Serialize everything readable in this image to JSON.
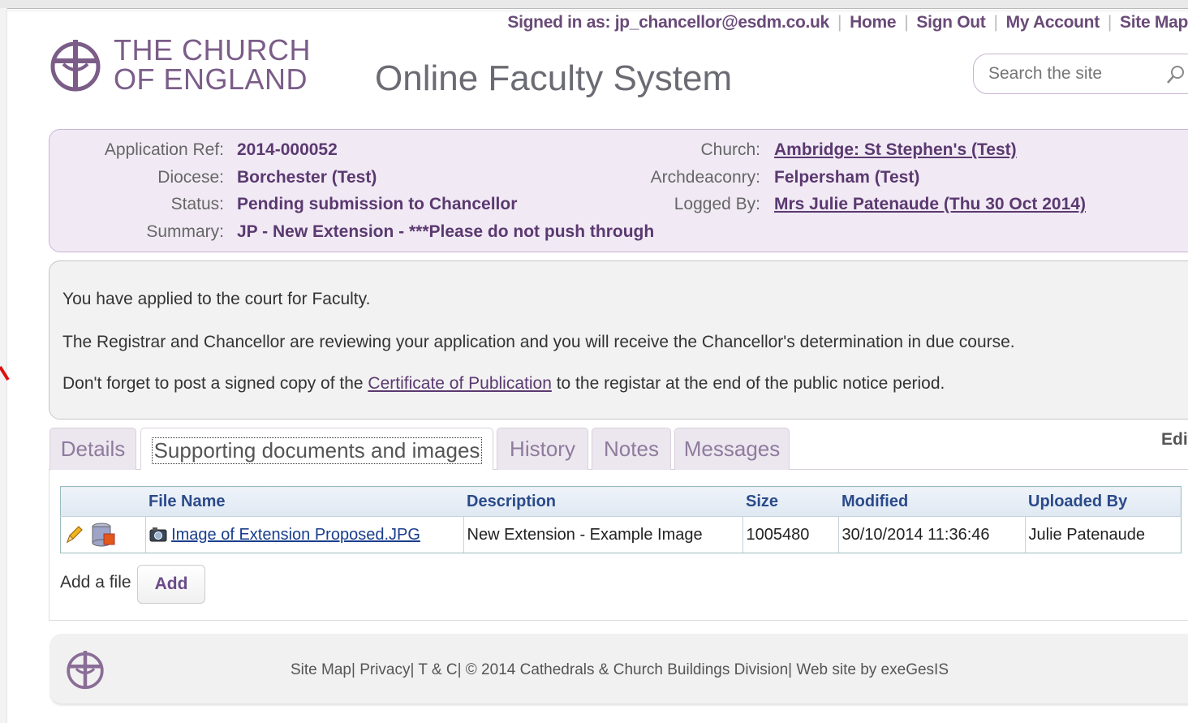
{
  "header": {
    "signed_in": "Signed in as: jp_chancellor@esdm.co.uk",
    "nav": [
      "Home",
      "Sign Out",
      "My Account",
      "Site Map"
    ],
    "logo_line1": "THE CHURCH",
    "logo_line2": "OF ENGLAND",
    "site_title": "Online Faculty System",
    "search_placeholder": "Search the site"
  },
  "application": {
    "ref_label": "Application Ref:",
    "ref": "2014-000052",
    "diocese_label": "Diocese:",
    "diocese": "Borchester (Test)",
    "status_label": "Status:",
    "status": "Pending submission to Chancellor",
    "summary_label": "Summary:",
    "summary": "JP - New Extension - ***Please do not push through",
    "church_label": "Church:",
    "church": "Ambridge: St Stephen's (Test)",
    "archdeaconry_label": "Archdeaconry:",
    "archdeaconry": "Felpersham (Test)",
    "logged_by_label": "Logged By:",
    "logged_by": "Mrs Julie Patenaude (Thu 30 Oct 2014)"
  },
  "message": {
    "line1": "You have applied to the court for Faculty.",
    "line2": "The Registrar and Chancellor are reviewing your application and you will receive the Chancellor's determination in due course.",
    "line3_before": "Don't forget to post a signed copy of the ",
    "line3_link": "Certificate of Publication",
    "line3_after": " to the registar at the end of the public notice period."
  },
  "tabs": [
    "Details",
    "Supporting documents and images",
    "History",
    "Notes",
    "Messages"
  ],
  "active_tab": "Supporting documents and images",
  "edit_label": "Edit",
  "files_table": {
    "headers": [
      "File Name",
      "Description",
      "Size",
      "Modified",
      "Uploaded By"
    ],
    "rows": [
      {
        "file_name": "Image of Extension Proposed.JPG",
        "description": "New Extension - Example Image",
        "size": "1005480",
        "modified": "30/10/2014 11:36:46",
        "uploaded_by": "Julie Patenaude"
      }
    ]
  },
  "add_file": {
    "label": "Add a file",
    "button": "Add"
  },
  "footer": {
    "text": "Site Map| Privacy| T & C| © 2014 Cathedrals & Church Buildings Division| Web site by exeGesIS"
  },
  "colors": {
    "brand": "#7b5d88",
    "info_bg": "#f1eaf5",
    "link": "#5b3970"
  }
}
